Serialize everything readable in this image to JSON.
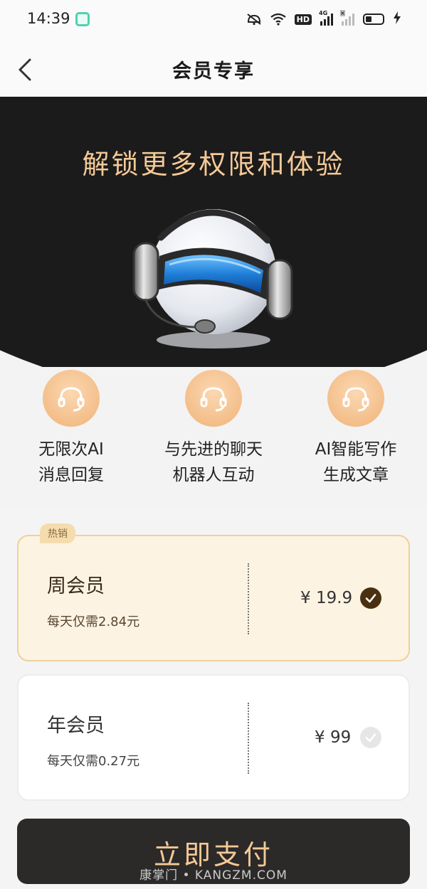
{
  "status_bar": {
    "time": "14:39",
    "icons": [
      "app-icon",
      "mute-icon",
      "wifi-icon",
      "hd-icon",
      "signal-4g-icon",
      "signal-off-icon",
      "battery-icon",
      "charging-icon"
    ],
    "hd_label": "HD",
    "network_label": "4G",
    "no_signal_mark": "×"
  },
  "nav": {
    "title": "会员专享",
    "back_icon": "chevron-left-icon"
  },
  "hero": {
    "title": "解锁更多权限和体验",
    "image": "robot-headset-illustration"
  },
  "features": [
    {
      "line1": "无限次AI",
      "line2": "消息回复",
      "icon": "headset-icon"
    },
    {
      "line1": "与先进的聊天",
      "line2": "机器人互动",
      "icon": "headset-icon"
    },
    {
      "line1": "AI智能写作",
      "line2": "生成文章",
      "icon": "headset-icon"
    }
  ],
  "plans": {
    "hot_badge": "热销",
    "items": [
      {
        "name": "周会员",
        "daily": "每天仅需2.84元",
        "price": "¥ 19.9",
        "selected": true
      },
      {
        "name": "年会员",
        "daily": "每天仅需0.27元",
        "price": "¥ 99",
        "selected": false
      }
    ]
  },
  "pay_button": {
    "label": "立即支付"
  },
  "watermark": "康掌门 • KANGZM.COM",
  "colors": {
    "accent_gold": "#f4c996",
    "dark": "#1b1b1b",
    "selected_card_bg": "#fdf3e3",
    "selected_card_border": "#efd09a",
    "check_on": "#4a3010"
  }
}
